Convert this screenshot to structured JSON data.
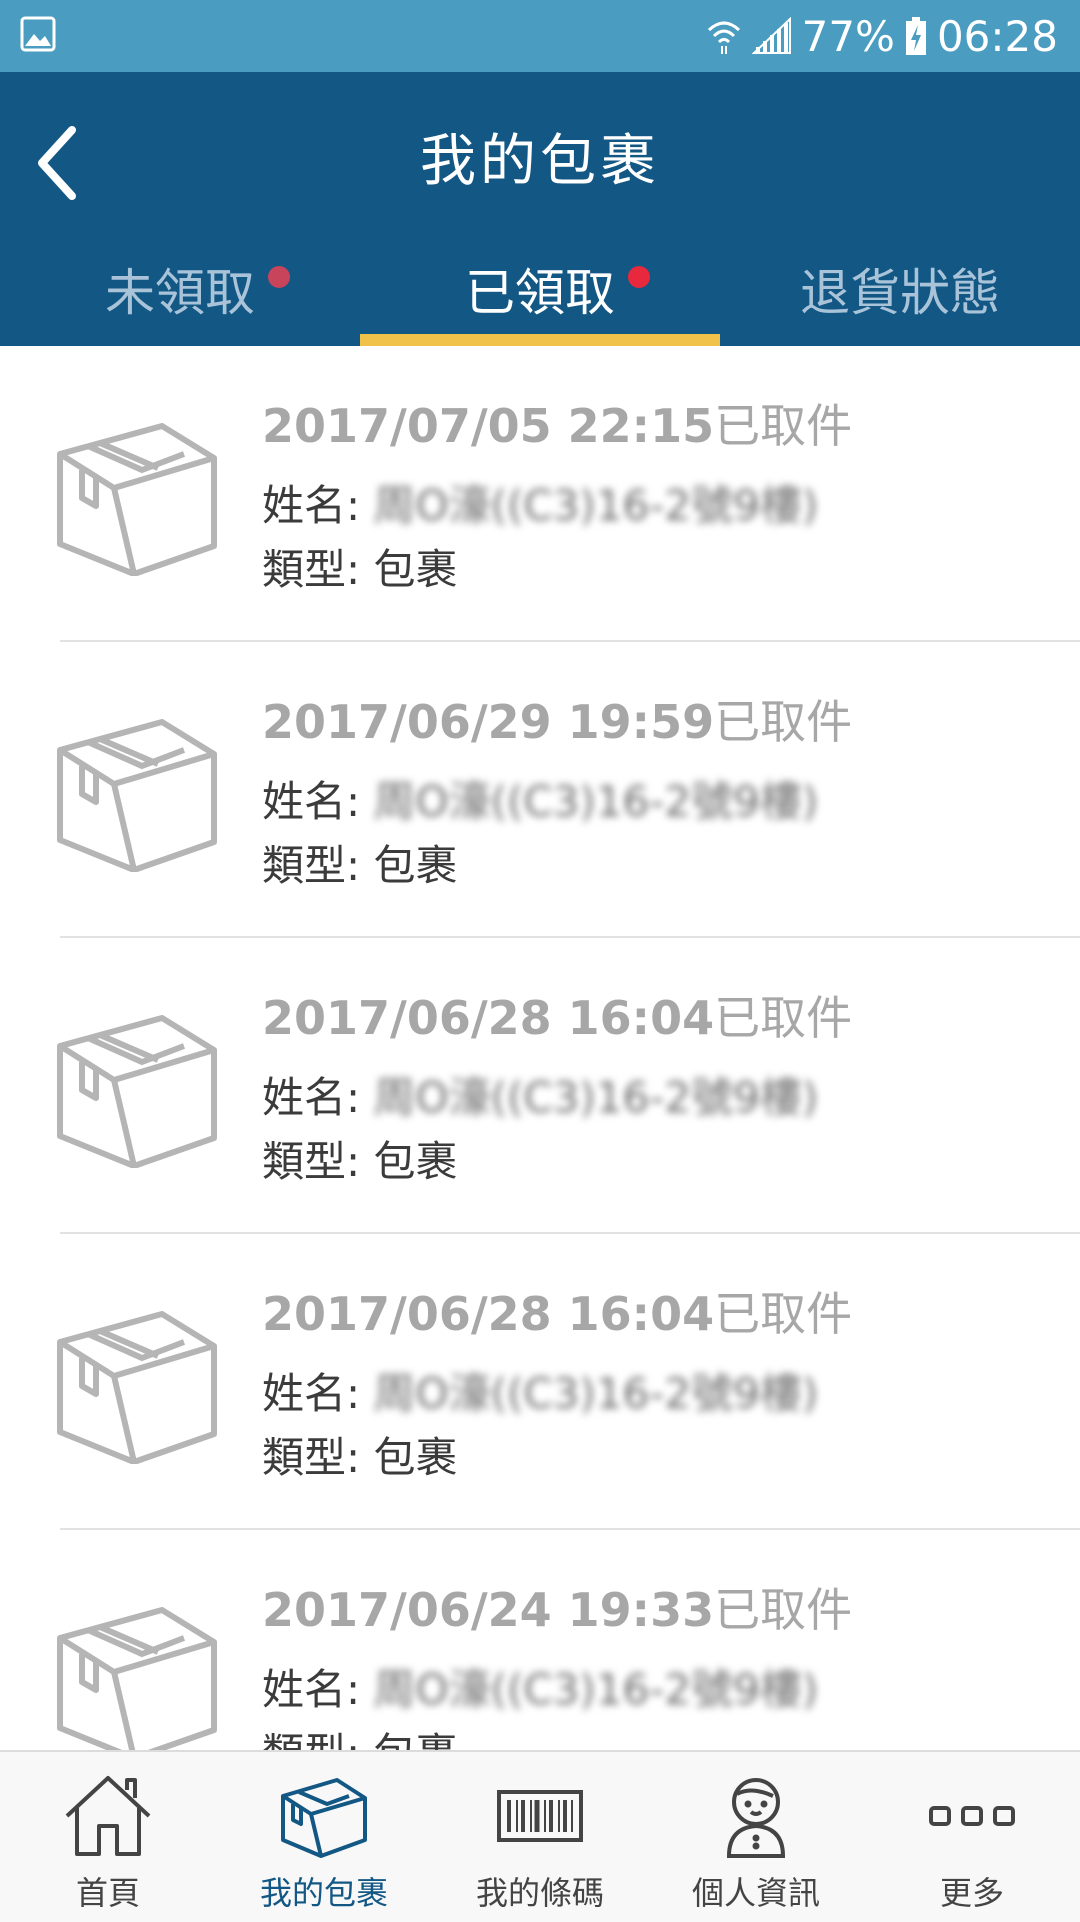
{
  "status_bar": {
    "battery": "77%",
    "time": "06:28"
  },
  "header": {
    "title": "我的包裹"
  },
  "tabs": [
    {
      "label": "未領取",
      "active": false,
      "badge_color": "#c8445a"
    },
    {
      "label": "已領取",
      "active": true,
      "badge_color": "#e8283c"
    },
    {
      "label": "退貨狀態",
      "active": false
    }
  ],
  "colors": {
    "header_bg": "#135785",
    "status_bg": "#4a9cc0",
    "tab_indicator": "#f0c24a"
  },
  "packages": [
    {
      "datetime": "2017/07/05 22:15",
      "status": "已取件",
      "name_label": "姓名:",
      "name_value": "周O濠((C3)16-2號9樓)",
      "type_label": "類型:",
      "type_value": "包裹"
    },
    {
      "datetime": "2017/06/29 19:59",
      "status": "已取件",
      "name_label": "姓名:",
      "name_value": "周O濠((C3)16-2號9樓)",
      "type_label": "類型:",
      "type_value": "包裹"
    },
    {
      "datetime": "2017/06/28 16:04",
      "status": "已取件",
      "name_label": "姓名:",
      "name_value": "周O濠((C3)16-2號9樓)",
      "type_label": "類型:",
      "type_value": "包裹"
    },
    {
      "datetime": "2017/06/28 16:04",
      "status": "已取件",
      "name_label": "姓名:",
      "name_value": "周O濠((C3)16-2號9樓)",
      "type_label": "類型:",
      "type_value": "包裹"
    },
    {
      "datetime": "2017/06/24 19:33",
      "status": "已取件",
      "name_label": "姓名:",
      "name_value": "周O濠((C3)16-2號9樓)",
      "type_label": "類型:",
      "type_value": "包裹"
    }
  ],
  "bottom_nav": [
    {
      "label": "首頁",
      "icon": "home-icon"
    },
    {
      "label": "我的包裹",
      "icon": "package-icon",
      "active": true
    },
    {
      "label": "我的條碼",
      "icon": "barcode-icon"
    },
    {
      "label": "個人資訊",
      "icon": "person-icon"
    },
    {
      "label": "更多",
      "icon": "more-icon"
    }
  ]
}
